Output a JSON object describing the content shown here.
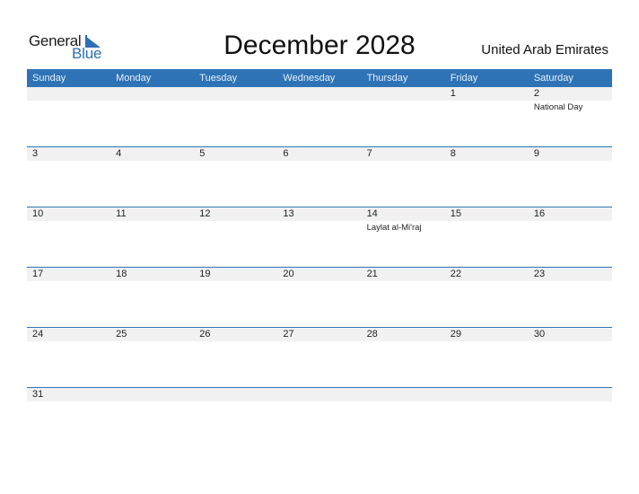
{
  "logo": {
    "line1": "General",
    "line2": "Blue"
  },
  "title": "December 2028",
  "country": "United Arab Emirates",
  "weekdays": [
    "Sunday",
    "Monday",
    "Tuesday",
    "Wednesday",
    "Thursday",
    "Friday",
    "Saturday"
  ],
  "weeks": [
    {
      "days": [
        "",
        "",
        "",
        "",
        "",
        "1",
        "2"
      ],
      "events": [
        "",
        "",
        "",
        "",
        "",
        "",
        "National Day"
      ]
    },
    {
      "days": [
        "3",
        "4",
        "5",
        "6",
        "7",
        "8",
        "9"
      ],
      "events": [
        "",
        "",
        "",
        "",
        "",
        "",
        ""
      ]
    },
    {
      "days": [
        "10",
        "11",
        "12",
        "13",
        "14",
        "15",
        "16"
      ],
      "events": [
        "",
        "",
        "",
        "",
        "Laylat al-Mi'raj",
        "",
        ""
      ]
    },
    {
      "days": [
        "17",
        "18",
        "19",
        "20",
        "21",
        "22",
        "23"
      ],
      "events": [
        "",
        "",
        "",
        "",
        "",
        "",
        ""
      ]
    },
    {
      "days": [
        "24",
        "25",
        "26",
        "27",
        "28",
        "29",
        "30"
      ],
      "events": [
        "",
        "",
        "",
        "",
        "",
        "",
        ""
      ]
    },
    {
      "days": [
        "31",
        "",
        "",
        "",
        "",
        "",
        ""
      ],
      "events": [
        "",
        "",
        "",
        "",
        "",
        "",
        ""
      ]
    }
  ],
  "colors": {
    "accent": "#2e73b5",
    "day_bar": "#f1f1f1"
  }
}
